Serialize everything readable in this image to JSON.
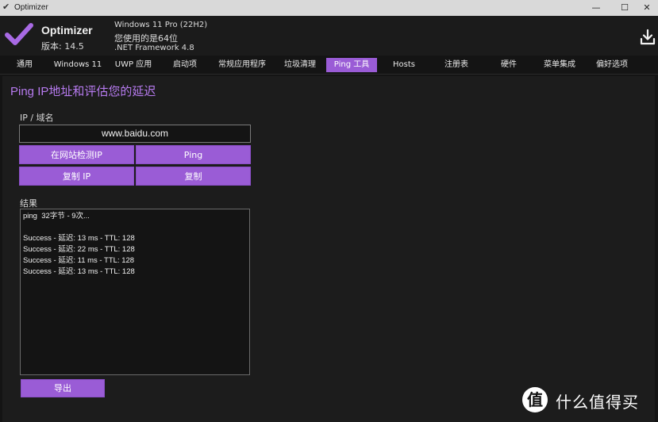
{
  "window": {
    "title": "Optimizer",
    "controls": {
      "minimize": "—",
      "maximize": "☐",
      "close": "✕"
    }
  },
  "header": {
    "app_name": "Optimizer",
    "version": "版本: 14.5",
    "os_line": "Windows 11 Pro (22H2)",
    "arch_line": "您使用的是64位",
    "framework_line": ".NET Framework 4.8",
    "download_icon": "download-icon"
  },
  "tabs": [
    {
      "label": "通用"
    },
    {
      "label": "Windows 11"
    },
    {
      "label": "UWP 应用"
    },
    {
      "label": "启动项"
    },
    {
      "label": "常规应用程序"
    },
    {
      "label": "垃圾清理"
    },
    {
      "label": "Ping 工具",
      "active": true
    },
    {
      "label": "Hosts"
    },
    {
      "label": "注册表"
    },
    {
      "label": "硬件"
    },
    {
      "label": "菜单集成"
    },
    {
      "label": "偏好选项"
    }
  ],
  "ping": {
    "page_title": "Ping IP地址和评估您的延迟",
    "ip_label": "IP / 域名",
    "ip_value": "www.baidu.com",
    "btn_check_site": "在网站检测IP",
    "btn_ping": "Ping",
    "btn_copy_ip": "复制 IP",
    "btn_copy": "复制",
    "result_label": "结果",
    "result_lines": [
      "ping  32字节 - 9次...",
      "",
      "Success - 延迟: 13 ms - TTL: 128",
      "Success - 延迟: 22 ms - TTL: 128",
      "Success - 延迟: 11 ms - TTL: 128",
      "Success - 延迟: 13 ms - TTL: 128"
    ],
    "btn_export": "导出"
  },
  "watermark": {
    "badge": "值",
    "text": "什么值得买"
  },
  "colors": {
    "accent": "#9a5cd6",
    "title_accent": "#b77bf0",
    "background": "#1c1c1c"
  }
}
